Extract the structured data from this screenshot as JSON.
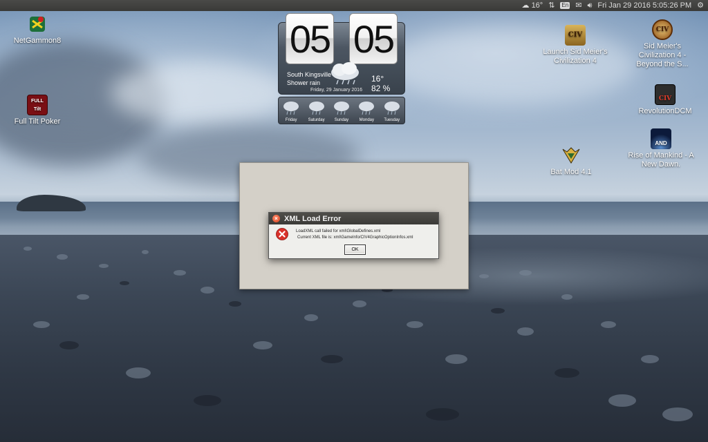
{
  "panel": {
    "temp": "16°",
    "keyboard": "En",
    "datetime": "Fri Jan 29 2016  5:05:26 PM"
  },
  "desktop_icons": [
    {
      "label": "NetGammon8"
    },
    {
      "label": "Full Tilt Poker"
    },
    {
      "label": "Launch Sid Meier's Civilization 4"
    },
    {
      "label": "Sid Meier's Civilization 4 - Beyond the S..."
    },
    {
      "label": "RevolutionDCM"
    },
    {
      "label": "Bat Mod 4.1"
    },
    {
      "label": "Rise of Mankind - A New Dawn."
    }
  ],
  "icon_badges": {
    "fulltilt": "FULL Tilt",
    "civ": "CIV",
    "revolution": "CIV",
    "rom": "AND"
  },
  "clock_widget": {
    "hour": "05",
    "minute": "05",
    "city": "South Kingsville",
    "condition": "Shower rain",
    "date": "Friday, 29 January 2016",
    "temperature": "16°",
    "humidity": "82 %"
  },
  "forecast": [
    {
      "day": "Friday"
    },
    {
      "day": "Saturday"
    },
    {
      "day": "Sunday"
    },
    {
      "day": "Monday"
    },
    {
      "day": "Tuesday"
    }
  ],
  "dialog": {
    "title": "XML Load Error",
    "line1": "LoadXML call failed for xml\\GlobalDefines.xml",
    "line2": "Current XML file is: xml\\GameInfo/CIV4GraphicOptionInfos.xml",
    "ok_label": "OK"
  },
  "colors": {
    "error_red": "#d9312a",
    "panel_bg": "#3f3e3c",
    "dialog_bg": "#efefec"
  }
}
